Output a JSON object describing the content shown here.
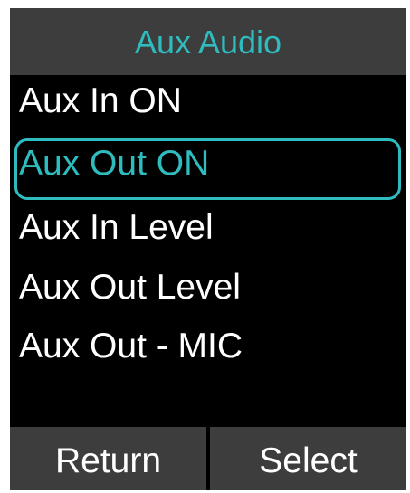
{
  "header": {
    "title": "Aux Audio"
  },
  "menu": {
    "items": [
      {
        "label": "Aux In ON",
        "selected": false
      },
      {
        "label": "Aux Out ON",
        "selected": true
      },
      {
        "label": "Aux In Level",
        "selected": false
      },
      {
        "label": "Aux Out Level",
        "selected": false
      },
      {
        "label": "Aux Out - MIC",
        "selected": false
      }
    ]
  },
  "softkeys": {
    "left_label": "Return",
    "right_label": "Select"
  },
  "colors": {
    "accent": "#2fbcbf",
    "background": "#000000",
    "bar": "#3d3d3d",
    "text": "#ffffff"
  }
}
